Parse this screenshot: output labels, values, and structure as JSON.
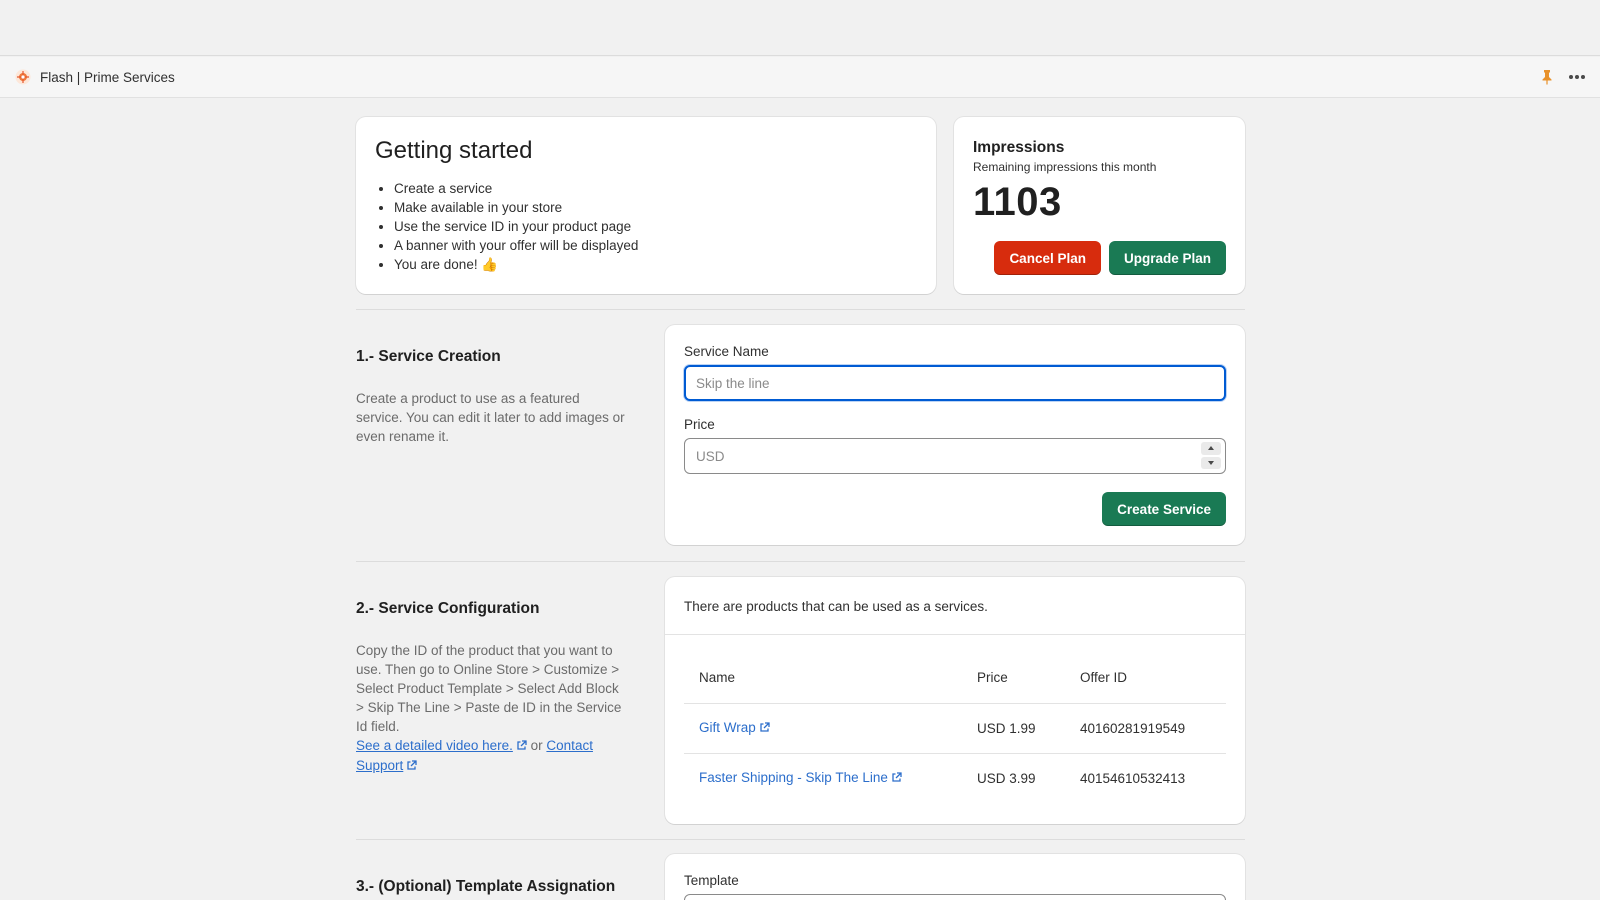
{
  "app": {
    "title": "Flash | Prime Services",
    "logo_icon": "flash-logo-icon",
    "pin_icon": "pin-icon",
    "more_icon": "more-horizontal-icon"
  },
  "getting_started": {
    "title": "Getting started",
    "steps": [
      "Create a service",
      "Make available in your store",
      "Use the service ID in your product page",
      "A banner with your offer will be displayed",
      "You are done! 👍"
    ]
  },
  "impressions": {
    "title": "Impressions",
    "subtitle": "Remaining impressions this month",
    "value": "1103",
    "cancel_label": "Cancel Plan",
    "upgrade_label": "Upgrade Plan"
  },
  "section1": {
    "title": "1.- Service Creation",
    "description": "Create a product to use as a featured service. You can edit it later to add images or even rename it.",
    "service_name_label": "Service Name",
    "service_name_placeholder": "Skip the line",
    "service_name_value": "",
    "price_label": "Price",
    "price_placeholder": "USD",
    "price_value": "",
    "create_label": "Create Service"
  },
  "section2": {
    "title": "2.- Service Configuration",
    "description": "Copy the ID of the product that you want to use. Then go to Online Store > Customize > Select Product Template > Select Add Block > Skip The Line > Paste de ID in the Service Id field.",
    "video_link": "See a detailed video here.",
    "or_text": "or",
    "contact_link_1": "Contact",
    "contact_link_2": "Support",
    "card_text": "There are products that can be used as a services.",
    "columns": [
      "Name",
      "Price",
      "Offer ID"
    ],
    "rows": [
      {
        "name": "Gift Wrap",
        "price": "USD 1.99",
        "offer_id": "40160281919549"
      },
      {
        "name": "Faster Shipping - Skip The Line",
        "price": "USD 3.99",
        "offer_id": "40154610532413"
      }
    ]
  },
  "section3": {
    "title": "3.- (Optional) Template Assignation",
    "template_label": "Template"
  },
  "colors": {
    "accent_green": "#1a7a54",
    "danger_red": "#d72c0d",
    "link_blue": "#2c6ecb",
    "focus_blue": "#005bd3"
  }
}
